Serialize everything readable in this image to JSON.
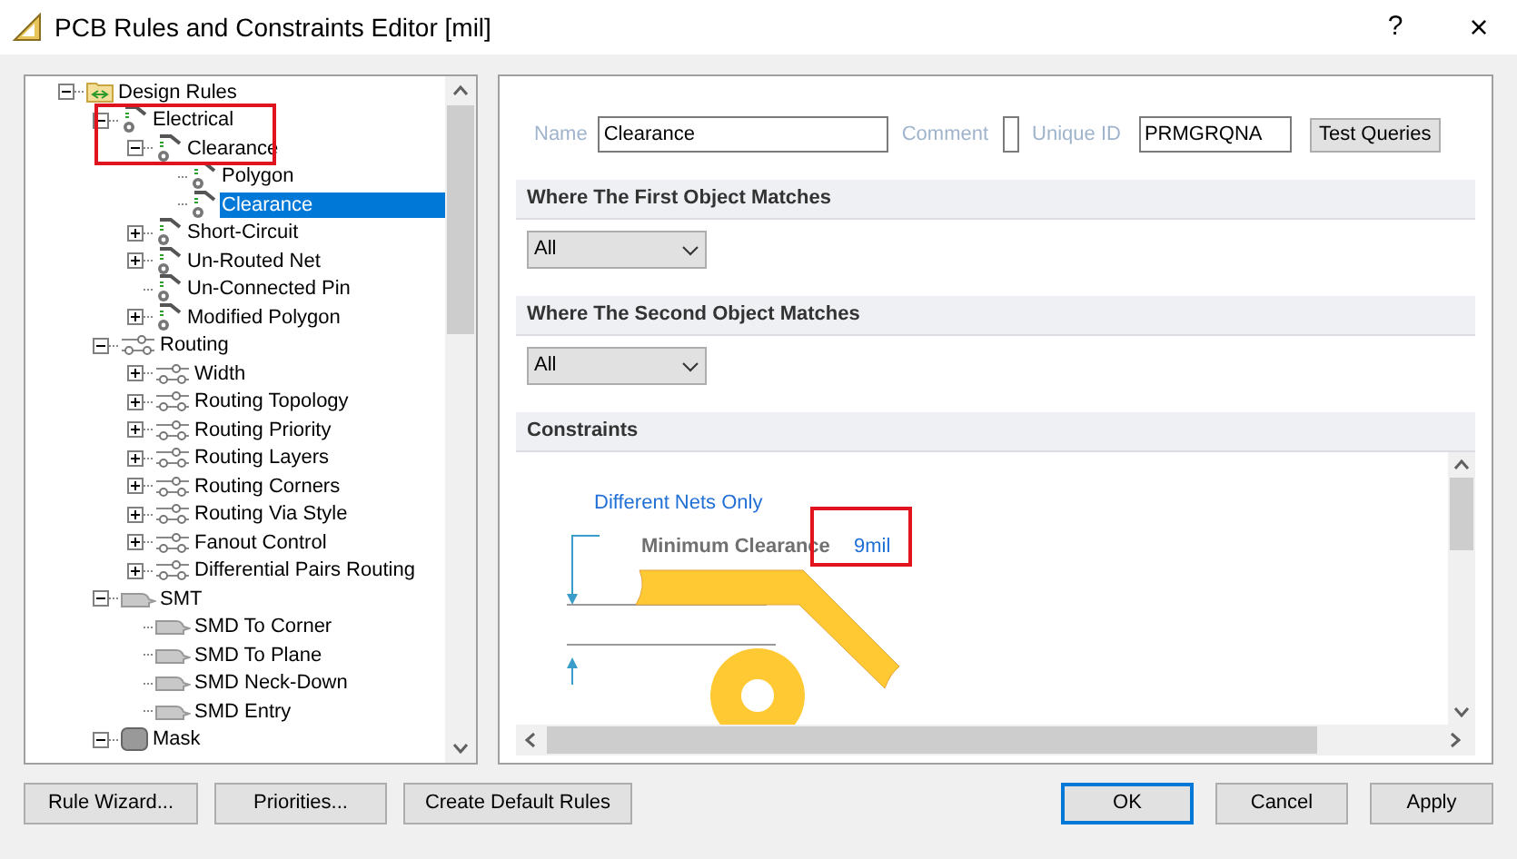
{
  "window": {
    "title": "PCB Rules and Constraints Editor [mil]",
    "help": "?",
    "close": "×"
  },
  "tree": [
    {
      "label": "Design Rules",
      "kind": "folder",
      "expanded": true,
      "selected": false,
      "children": [
        {
          "label": "Electrical",
          "kind": "electrical",
          "expanded": true,
          "selected": false,
          "children": [
            {
              "label": "Clearance",
              "kind": "electrical",
              "expanded": true,
              "selected": false,
              "children": [
                {
                  "label": "Polygon",
                  "kind": "electrical",
                  "selected": false
                },
                {
                  "label": "Clearance",
                  "kind": "electrical",
                  "selected": true
                }
              ]
            },
            {
              "label": "Short-Circuit",
              "kind": "electrical",
              "expanded": false,
              "selected": false
            },
            {
              "label": "Un-Routed Net",
              "kind": "electrical",
              "expanded": false,
              "selected": false
            },
            {
              "label": "Un-Connected Pin",
              "kind": "electrical",
              "selected": false
            },
            {
              "label": "Modified Polygon",
              "kind": "electrical",
              "expanded": false,
              "selected": false
            }
          ]
        },
        {
          "label": "Routing",
          "kind": "routing",
          "expanded": true,
          "selected": false,
          "children": [
            {
              "label": "Width",
              "kind": "routing",
              "expanded": false,
              "selected": false
            },
            {
              "label": "Routing Topology",
              "kind": "routing",
              "expanded": false,
              "selected": false
            },
            {
              "label": "Routing Priority",
              "kind": "routing",
              "expanded": false,
              "selected": false
            },
            {
              "label": "Routing Layers",
              "kind": "routing",
              "expanded": false,
              "selected": false
            },
            {
              "label": "Routing Corners",
              "kind": "routing",
              "expanded": false,
              "selected": false
            },
            {
              "label": "Routing Via Style",
              "kind": "routing",
              "expanded": false,
              "selected": false
            },
            {
              "label": "Fanout Control",
              "kind": "routing",
              "expanded": false,
              "selected": false
            },
            {
              "label": "Differential Pairs Routing",
              "kind": "routing",
              "expanded": false,
              "selected": false
            }
          ]
        },
        {
          "label": "SMT",
          "kind": "smt",
          "expanded": true,
          "selected": false,
          "children": [
            {
              "label": "SMD To Corner",
              "kind": "smt",
              "selected": false
            },
            {
              "label": "SMD To Plane",
              "kind": "smt",
              "selected": false
            },
            {
              "label": "SMD Neck-Down",
              "kind": "smt",
              "selected": false
            },
            {
              "label": "SMD Entry",
              "kind": "smt",
              "selected": false
            }
          ]
        },
        {
          "label": "Mask",
          "kind": "mask",
          "expanded": true,
          "selected": false
        }
      ]
    }
  ],
  "rule": {
    "name_label": "Name",
    "name": "Clearance",
    "comment_label": "Comment",
    "unique_id_label": "Unique ID",
    "unique_id": "PRMGRQNA",
    "test_button": "Test Queries"
  },
  "sections": [
    {
      "title": "Where The First Object Matches",
      "value": "All"
    },
    {
      "title": "Where The Second Object Matches",
      "value": "All"
    }
  ],
  "constraints": {
    "title": "Constraints",
    "net_scope": "Different Nets Only",
    "label": "Minimum Clearance",
    "value": "9mil"
  },
  "footer_left": [
    "Rule Wizard...",
    "Priorities...",
    "Create Default Rules"
  ],
  "footer_right": [
    "OK",
    "Cancel",
    "Apply"
  ]
}
